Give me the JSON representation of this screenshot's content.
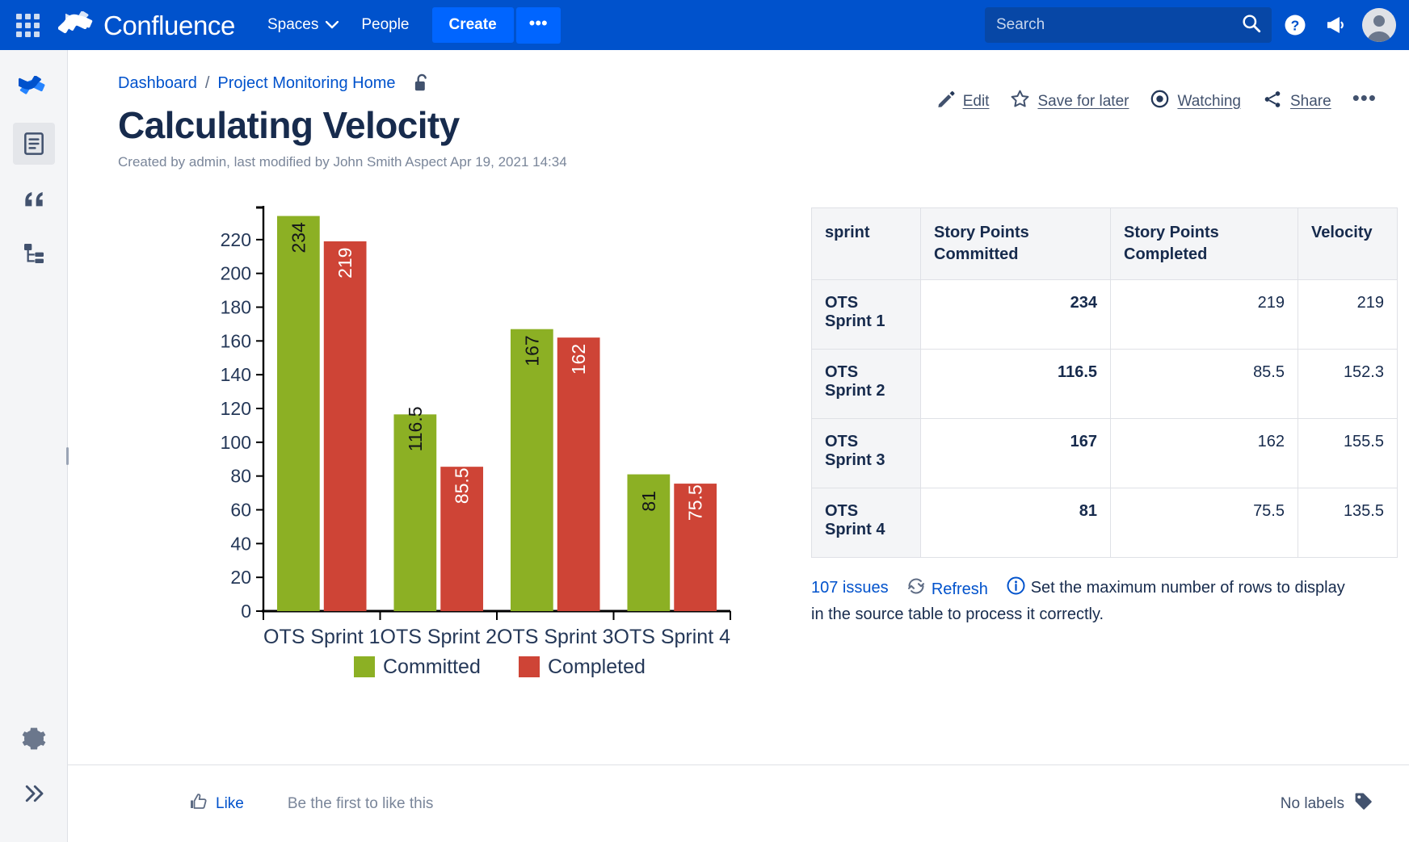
{
  "nav": {
    "app_switcher": "app-switcher",
    "brand": "Confluence",
    "spaces": "Spaces",
    "people": "People",
    "create": "Create",
    "more": "•••",
    "search_placeholder": "Search",
    "search_value": ""
  },
  "sidebar": {
    "items": [
      {
        "name": "confluence-logo-icon",
        "label": "Confluence"
      },
      {
        "name": "pages-icon",
        "label": "Pages"
      },
      {
        "name": "blog-quote-icon",
        "label": "Blog"
      },
      {
        "name": "page-tree-icon",
        "label": "Page tree"
      }
    ],
    "bottom": [
      {
        "name": "settings-gear-icon",
        "label": "Settings"
      },
      {
        "name": "expand-sidebar-icon",
        "label": "Expand"
      }
    ]
  },
  "breadcrumb": {
    "dashboard": "Dashboard",
    "separator": "/",
    "space": "Project Monitoring Home",
    "restriction": "unlocked"
  },
  "page": {
    "title": "Calculating Velocity",
    "meta": "Created by admin, last modified by John Smith Aspect Apr 19, 2021 14:34"
  },
  "actions": {
    "edit": "Edit",
    "edit_key": "E",
    "edit_rest": "dit",
    "save_for_later_a": "Save ",
    "save_for_later_key": "f",
    "save_for_later_rest": "or later",
    "watching_key": "W",
    "watching_rest": "atching",
    "share": "Share",
    "more": "•••"
  },
  "chart_data": {
    "type": "bar",
    "title": "",
    "xlabel": "",
    "ylabel": "",
    "categories": [
      "OTS Sprint 1",
      "OTS Sprint 2",
      "OTS Sprint 3",
      "OTS Sprint 4"
    ],
    "series": [
      {
        "name": "Committed",
        "color": "#8CB024",
        "values": [
          234,
          116.5,
          167,
          81
        ]
      },
      {
        "name": "Completed",
        "color": "#CE4436",
        "values": [
          219,
          85.5,
          162,
          75.5
        ]
      }
    ],
    "ylim": [
      0,
      240
    ],
    "yticks": [
      0,
      20,
      40,
      60,
      80,
      100,
      120,
      140,
      160,
      180,
      200,
      220
    ],
    "bar_labels": [
      [
        "234",
        "219"
      ],
      [
        "116.5",
        "85.5"
      ],
      [
        "167",
        "162"
      ],
      [
        "81",
        "75.5"
      ]
    ],
    "grid": false,
    "legend_position": "bottom"
  },
  "table": {
    "headers": [
      "sprint",
      "Story Points Committed",
      "Story Points Completed",
      "Velocity"
    ],
    "rows": [
      {
        "sprint": "OTS Sprint 1",
        "committed": "234",
        "completed": "219",
        "velocity": "219"
      },
      {
        "sprint": "OTS Sprint 2",
        "committed": "116.5",
        "completed": "85.5",
        "velocity": "152.3"
      },
      {
        "sprint": "OTS Sprint 3",
        "committed": "167",
        "completed": "162",
        "velocity": "155.5"
      },
      {
        "sprint": "OTS Sprint 4",
        "committed": "81",
        "completed": "75.5",
        "velocity": "135.5"
      }
    ],
    "footer": {
      "issues": "107 issues",
      "refresh": "Refresh",
      "note": "Set the maximum number of rows to display in the source table to process it correctly."
    }
  },
  "footer": {
    "like": "Like",
    "first_to_like": "Be the first to like this",
    "no_labels": "No labels"
  },
  "colors": {
    "brand_blue": "#0052CC",
    "create_blue": "#0065FF",
    "search_bg": "#0747A6",
    "committed_green": "#8CB024",
    "completed_red": "#CE4436",
    "text_dark": "#172B4D",
    "text_sub": "#7A869A",
    "border": "#DFE1E6",
    "panel_bg": "#F4F5F7"
  }
}
